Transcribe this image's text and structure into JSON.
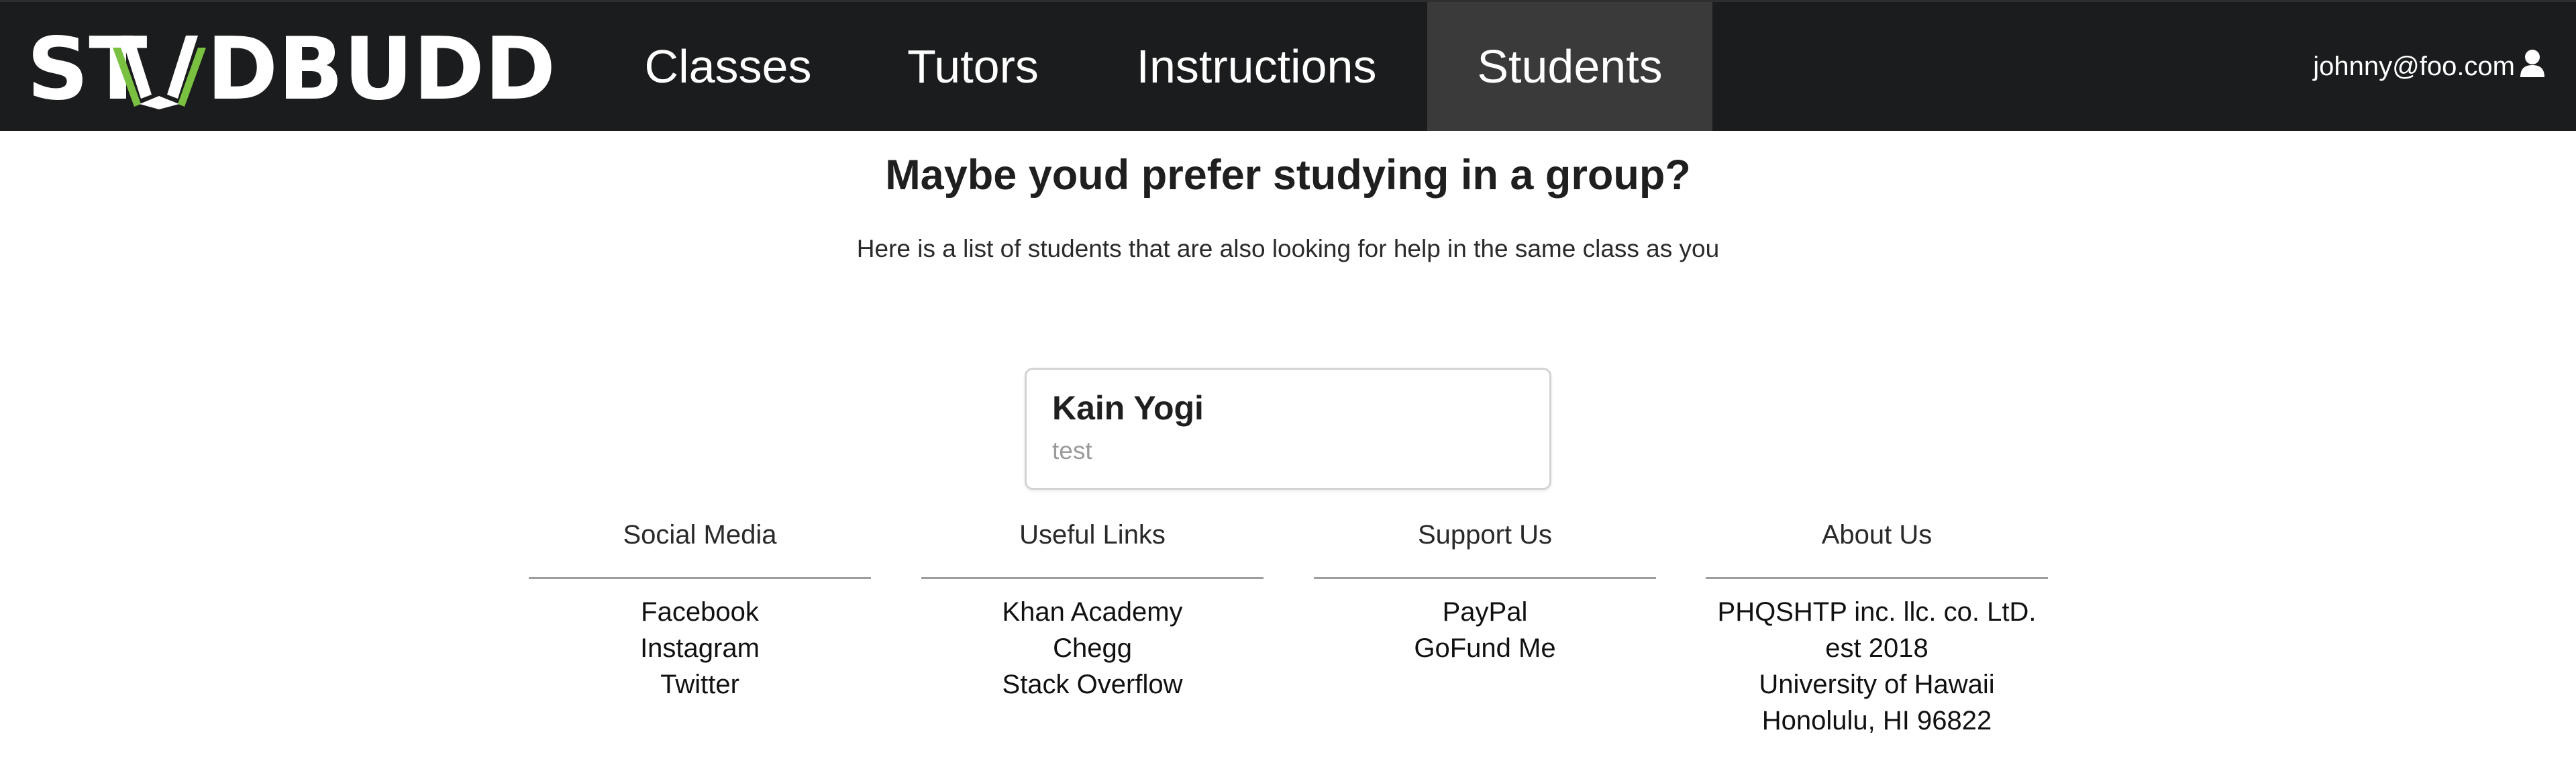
{
  "brand": {
    "logo_text": "STUDBUDD",
    "accent_color": "#7ac142"
  },
  "nav": {
    "items": [
      {
        "label": "Classes"
      },
      {
        "label": "Tutors"
      },
      {
        "label": "Instructions"
      },
      {
        "label": "Students",
        "active": true
      }
    ]
  },
  "user": {
    "email": "johnny@foo.com",
    "icon": "user-icon"
  },
  "main": {
    "title": "Maybe youd prefer studying in a group?",
    "subtitle": "Here is a list of students that are also looking for help in the same class as you",
    "students": [
      {
        "name": "Kain Yogi",
        "meta": "test"
      }
    ]
  },
  "footer": {
    "social": {
      "title": "Social Media",
      "links": [
        "Facebook",
        "Instagram",
        "Twitter"
      ]
    },
    "useful": {
      "title": "Useful Links",
      "links": [
        "Khan Academy",
        "Chegg",
        "Stack Overflow"
      ]
    },
    "support": {
      "title": "Support Us",
      "links": [
        "PayPal",
        "GoFund Me"
      ]
    },
    "about": {
      "title": "About Us",
      "lines": [
        "PHQSHTP inc. llc. co. LtD. est 2018",
        "University of Hawaii",
        "Honolulu, HI 96822"
      ]
    }
  }
}
